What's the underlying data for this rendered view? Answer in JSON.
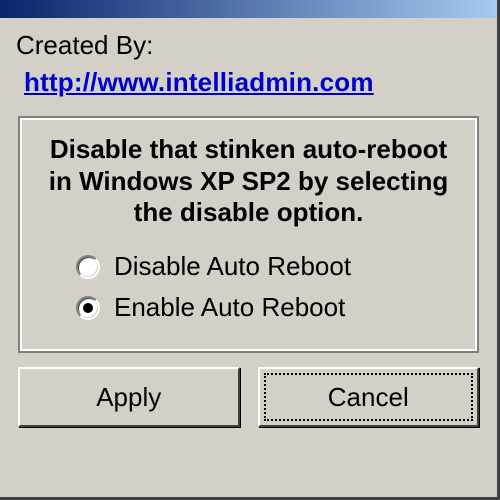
{
  "header": {
    "created_by_label": "Created By:",
    "link_text": "http://www.intelliadmin.com"
  },
  "group": {
    "heading": "Disable that stinken auto-reboot in Windows XP SP2 by selecting the disable option.",
    "options": {
      "disable": {
        "label": "Disable Auto Reboot",
        "selected": false
      },
      "enable": {
        "label": "Enable Auto Reboot",
        "selected": true
      }
    }
  },
  "buttons": {
    "apply": "Apply",
    "cancel": "Cancel"
  }
}
